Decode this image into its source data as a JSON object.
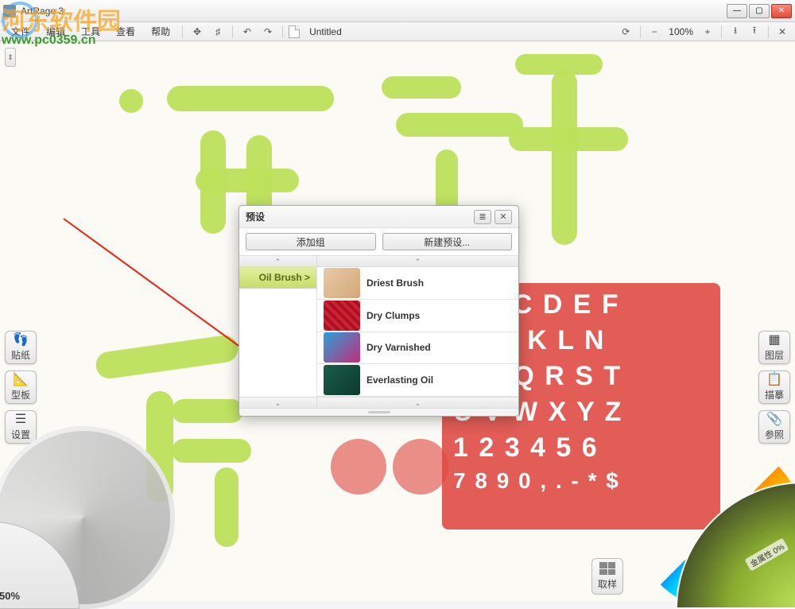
{
  "window": {
    "title": "ArtRage 3"
  },
  "win_controls": {
    "min": "—",
    "max": "▢",
    "close": "✕"
  },
  "menu": {
    "file": "文件",
    "edit": "编辑",
    "tools": "工具",
    "view": "查看",
    "help": "帮助",
    "move": "✥",
    "grid": "♯",
    "undo": "↶",
    "redo": "↷",
    "doc_name": "Untitled",
    "rotate": "⟳",
    "zoom_out": "−",
    "zoom_val": "100%",
    "zoom_in": "+",
    "import": "⭳",
    "export": "⭱",
    "close_doc": "✕"
  },
  "ruler": {
    "glyph": "⇕"
  },
  "sidebar_left": {
    "stickers": {
      "label": "贴纸",
      "icon": "👣"
    },
    "stencils": {
      "label": "型板",
      "icon": "📐"
    },
    "settings": {
      "label": "设置",
      "icon": "☰"
    }
  },
  "sidebar_right": {
    "layers": {
      "label": "图层",
      "icon": "▦"
    },
    "tracing": {
      "label": "描摹",
      "icon": "📋"
    },
    "refs": {
      "label": "参照",
      "icon": "📎"
    }
  },
  "tool_picker": {
    "size_pct": "50%"
  },
  "color_picker": {
    "metal_label": "金属性 0%"
  },
  "sample_btn": {
    "label": "取样"
  },
  "preset": {
    "title": "预设",
    "menu_icon": "≣",
    "close_icon": "✕",
    "add_group": "添加组",
    "new_preset": "新建预设...",
    "up": "⌃",
    "down": "⌄",
    "active_group": "Oil Brush  >",
    "items": [
      {
        "name": "Driest Brush"
      },
      {
        "name": "Dry Clumps"
      },
      {
        "name": "Dry Varnished"
      },
      {
        "name": "Everlasting Oil"
      }
    ]
  },
  "stencil": {
    "rows": [
      "A B C D E F",
      "H I J K L N",
      "O P Q R S T",
      "U V W X Y Z",
      "1 2 3 4 5 6",
      "7 8 9 0 , . - * $"
    ]
  },
  "watermark": {
    "cn": "河东软件园",
    "url": "www.pc0359.cn"
  }
}
